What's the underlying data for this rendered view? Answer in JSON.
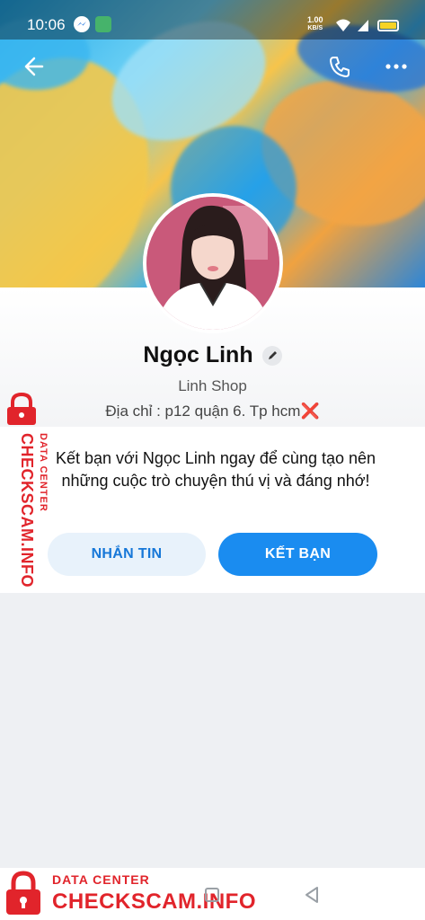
{
  "status_bar": {
    "time": "10:06",
    "speed_value": "1.00",
    "speed_unit": "KB/S",
    "icons": [
      "messenger-icon",
      "app-icon",
      "wifi-icon",
      "battery-icon"
    ]
  },
  "header": {
    "icons": [
      "back-arrow-icon",
      "phone-icon",
      "more-icon"
    ]
  },
  "profile": {
    "name": "Ngọc Linh",
    "shop": "Linh Shop",
    "address": "Địa chỉ : p12 quận 6. Tp hcm",
    "address_mark": "❌"
  },
  "invite": {
    "text": "Kết bạn với Ngọc Linh ngay để cùng tạo nên những cuộc trò chuyện thú vị và đáng nhớ!"
  },
  "actions": {
    "message_label": "NHẮN TIN",
    "add_friend_label": "KẾT BẠN"
  },
  "watermark": {
    "small": "DATA CENTER",
    "big": "CHECKSCAM.INFO"
  },
  "colors": {
    "primary": "#1a8cf0",
    "watermark": "#e1242b"
  }
}
